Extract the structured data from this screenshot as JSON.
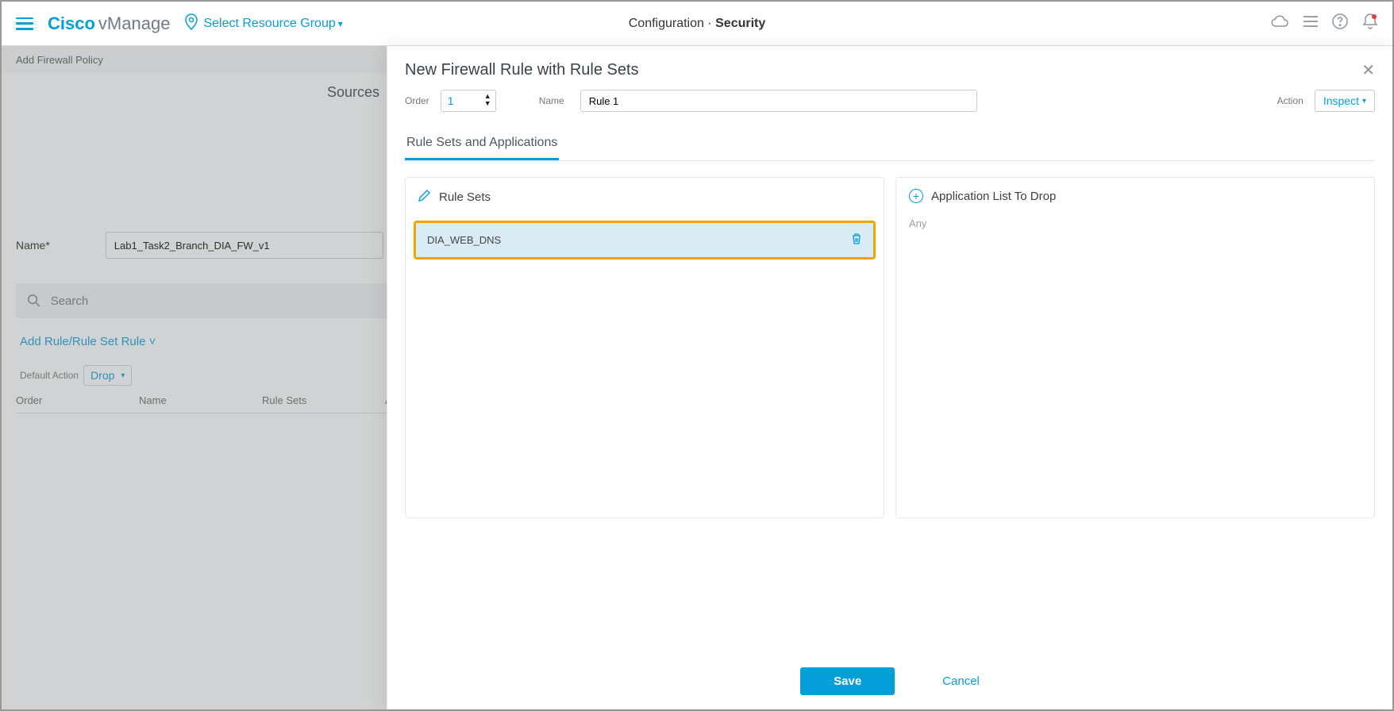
{
  "header": {
    "brand_bold": "Cisco",
    "brand_light": "vManage",
    "resource_group": "Select Resource Group",
    "breadcrumb_prefix": "Configuration · ",
    "breadcrumb_active": "Security"
  },
  "subheader": {
    "title": "Add Firewall Policy"
  },
  "background": {
    "sources_label": "Sources",
    "name_label": "Name*",
    "name_value": "Lab1_Task2_Branch_DIA_FW_v1",
    "search_placeholder": "Search",
    "add_rule_link": "Add Rule/Rule Set Rule",
    "default_action_label": "Default Action",
    "default_action_value": "Drop",
    "columns": {
      "order": "Order",
      "name": "Name",
      "rulesets": "Rule Sets",
      "action_initial": "A"
    }
  },
  "modal": {
    "title": "New Firewall Rule with Rule Sets",
    "order_label": "Order",
    "order_value": "1",
    "name_label": "Name",
    "name_value": "Rule 1",
    "action_label": "Action",
    "action_value": "Inspect",
    "tab_label": "Rule Sets and Applications",
    "rulesets_header": "Rule Sets",
    "ruleset_item": "DIA_WEB_DNS",
    "applist_header": "Application List To Drop",
    "applist_value": "Any",
    "save": "Save",
    "cancel": "Cancel"
  }
}
